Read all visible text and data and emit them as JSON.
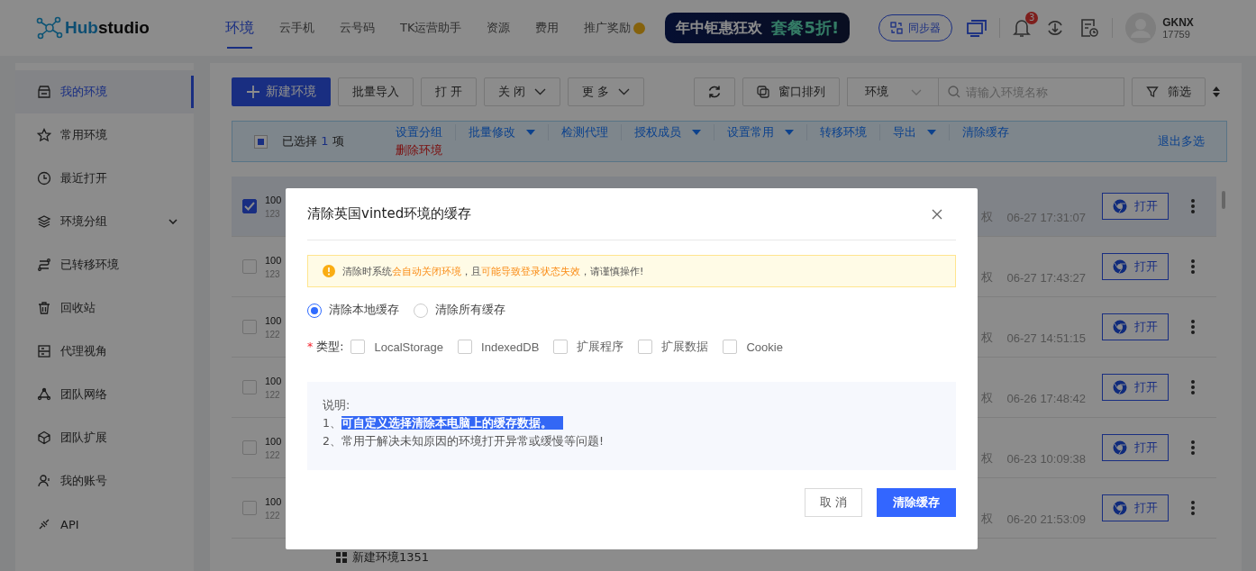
{
  "logo": {
    "accent": "Hub",
    "rest": "studio"
  },
  "nav": [
    {
      "label": "环境",
      "selected": true,
      "coin": false
    },
    {
      "label": "云手机",
      "selected": false,
      "coin": false
    },
    {
      "label": "云号码",
      "selected": false,
      "coin": false
    },
    {
      "label": "TK运营助手",
      "selected": false,
      "coin": false
    },
    {
      "label": "资源",
      "selected": false,
      "coin": false
    },
    {
      "label": "费用",
      "selected": false,
      "coin": false
    },
    {
      "label": "推广奖励",
      "selected": false,
      "coin": true
    }
  ],
  "banner": {
    "text": "年中钜惠狂欢",
    "offer": "套餐5折!"
  },
  "sync_button": "同步器",
  "notifications": {
    "count": "3"
  },
  "user": {
    "name": "GKNX",
    "phone": "17759"
  },
  "sidebar": {
    "items": [
      {
        "label": "我的环境",
        "selected": true,
        "expandable": false
      },
      {
        "label": "常用环境",
        "selected": false,
        "expandable": false
      },
      {
        "label": "最近打开",
        "selected": false,
        "expandable": false
      },
      {
        "label": "环境分组",
        "selected": false,
        "expandable": true
      },
      {
        "label": "已转移环境",
        "selected": false,
        "expandable": false
      },
      {
        "label": "回收站",
        "selected": false,
        "expandable": false
      },
      {
        "label": "代理视角",
        "selected": false,
        "expandable": false
      },
      {
        "label": "团队网络",
        "selected": false,
        "expandable": false
      },
      {
        "label": "团队扩展",
        "selected": false,
        "expandable": false
      },
      {
        "label": "我的账号",
        "selected": false,
        "expandable": false
      },
      {
        "label": "API",
        "selected": false,
        "expandable": false
      }
    ]
  },
  "toolbar": {
    "new_button": "新建环境",
    "buttons": [
      {
        "label": "批量导入",
        "dropdown": false
      },
      {
        "label": "打 开",
        "dropdown": false
      },
      {
        "label": "关 闭",
        "dropdown": true
      },
      {
        "label": "更 多",
        "dropdown": true
      }
    ],
    "arrange_button": "窗口排列",
    "scope_select": "环境",
    "search": {
      "placeholder": "请输入环境名称"
    },
    "filter_button": "筛选"
  },
  "selection_bar": {
    "checked": true,
    "before": "已选择",
    "count": "1",
    "after": "项",
    "actions": [
      {
        "label": "设置分组",
        "dropdown": false,
        "kind": "normal"
      },
      {
        "label": "批量修改",
        "dropdown": true,
        "kind": "normal"
      },
      {
        "label": "检测代理",
        "dropdown": false,
        "kind": "normal"
      },
      {
        "label": "授权成员",
        "dropdown": true,
        "kind": "normal"
      },
      {
        "label": "设置常用",
        "dropdown": true,
        "kind": "normal"
      },
      {
        "label": "转移环境",
        "dropdown": false,
        "kind": "normal"
      },
      {
        "label": "导出",
        "dropdown": true,
        "kind": "normal"
      },
      {
        "label": "清除缓存",
        "dropdown": false,
        "kind": "normal"
      },
      {
        "label": "删除环境",
        "dropdown": false,
        "kind": "danger"
      }
    ],
    "exit": "退出多选"
  },
  "rows": [
    {
      "checked": true,
      "code": "100",
      "sub": "123",
      "auth": "权",
      "time": "06-27 17:31:07",
      "open": "打开"
    },
    {
      "checked": false,
      "code": "100",
      "sub": "123",
      "auth": "权",
      "time": "06-27 17:43:27",
      "open": "打开"
    },
    {
      "checked": false,
      "code": "100",
      "sub": "122",
      "auth": "权",
      "time": "06-27 14:51:15",
      "open": "打开"
    },
    {
      "checked": false,
      "code": "100",
      "sub": "122",
      "auth": "权",
      "time": "06-26 17:48:42",
      "open": "打开"
    },
    {
      "checked": false,
      "code": "100",
      "sub": "122",
      "auth": "权",
      "time": "06-23 10:09:38",
      "open": "打开"
    },
    {
      "checked": false,
      "code": "100",
      "sub": "122",
      "auth": "权",
      "time": "06-20 21:53:09",
      "open": "打开"
    }
  ],
  "group_row": {
    "label": "新建环境1351"
  },
  "dialog": {
    "title": "清除英国vinted环境的缓存",
    "alert": [
      {
        "text": "清除时系统",
        "highlight": false
      },
      {
        "text": "会自动关闭环境",
        "highlight": true
      },
      {
        "text": "，且",
        "highlight": false
      },
      {
        "text": "可能导致登录状态失效",
        "highlight": true
      },
      {
        "text": "，请谨慎操作!",
        "highlight": false
      }
    ],
    "scope": [
      {
        "label": "清除本地缓存",
        "selected": true
      },
      {
        "label": "清除所有缓存",
        "selected": false
      }
    ],
    "type_label": "类型:",
    "required_mark": "*",
    "types": [
      {
        "label": "LocalStorage",
        "checked": false
      },
      {
        "label": "IndexedDB",
        "checked": false
      },
      {
        "label": "扩展程序",
        "checked": false
      },
      {
        "label": "扩展数据",
        "checked": false
      },
      {
        "label": "Cookie",
        "checked": false
      }
    ],
    "note_title": "说明:",
    "notes": [
      {
        "number": "1、",
        "text": "可自定义选择清除本电脑上的缓存数据。",
        "highlighted": true
      },
      {
        "number": "2、",
        "text": "常用于解决未知原因的环境打开异常或缓慢等问题!",
        "highlighted": false
      }
    ],
    "cancel": "取 消",
    "confirm": "清除缓存"
  }
}
